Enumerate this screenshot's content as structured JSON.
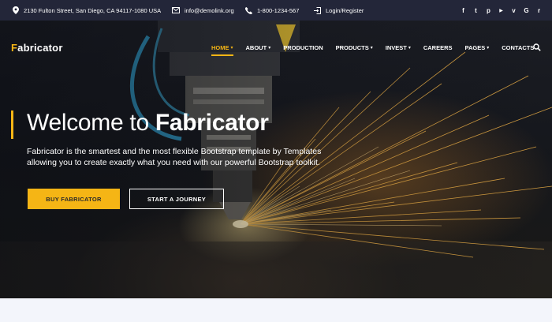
{
  "topbar": {
    "address": "2130 Fulton Street, San Diego, CA 94117-1080 USA",
    "email": "info@demolink.org",
    "phone": "1-800-1234-567",
    "login": "Login/Register",
    "socials": [
      {
        "name": "facebook-icon",
        "glyph": "f"
      },
      {
        "name": "twitter-icon",
        "glyph": "t"
      },
      {
        "name": "pinterest-icon",
        "glyph": "p"
      },
      {
        "name": "youtube-icon",
        "glyph": "▶"
      },
      {
        "name": "vimeo-icon",
        "glyph": "v"
      },
      {
        "name": "google-icon",
        "glyph": "G"
      },
      {
        "name": "rss-icon",
        "glyph": "r"
      }
    ]
  },
  "logo": {
    "first_letter": "F",
    "rest": "abricator"
  },
  "nav": {
    "items": [
      {
        "label": "HOME",
        "dropdown": true,
        "active": true
      },
      {
        "label": "ABOUT",
        "dropdown": true,
        "active": false
      },
      {
        "label": "PRODUCTION",
        "dropdown": false,
        "active": false
      },
      {
        "label": "PRODUCTS",
        "dropdown": true,
        "active": false
      },
      {
        "label": "INVEST",
        "dropdown": true,
        "active": false
      },
      {
        "label": "CAREERS",
        "dropdown": false,
        "active": false
      },
      {
        "label": "PAGES",
        "dropdown": true,
        "active": false
      },
      {
        "label": "CONTACTS",
        "dropdown": false,
        "active": false
      }
    ]
  },
  "hero": {
    "headline_light": "Welcome to ",
    "headline_bold": "Fabricator",
    "subtext": "Fabricator is the smartest and the most flexible Bootstrap template by Templates allowing you to create exactly what you need with our powerful Bootstrap toolkit.",
    "primary_button": "BUY FABRICATOR",
    "secondary_button": "START A JOURNEY"
  },
  "colors": {
    "accent": "#f5b515",
    "topbar_bg": "#232639",
    "text": "#ffffff"
  }
}
